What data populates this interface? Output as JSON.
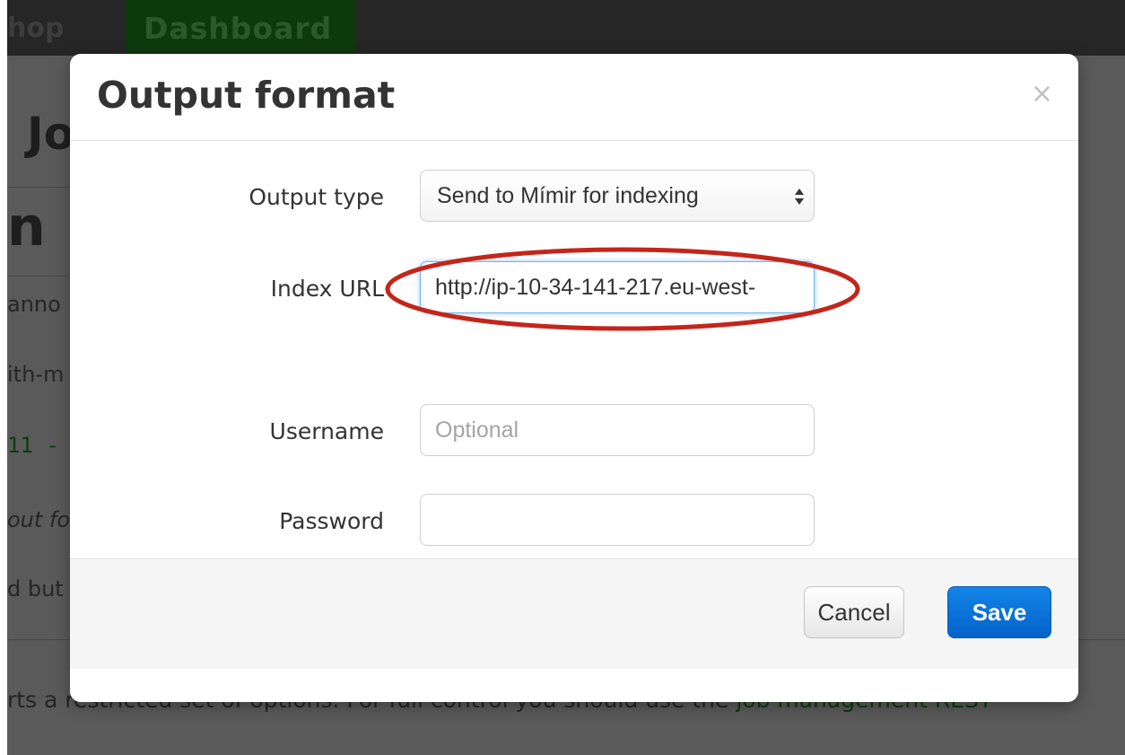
{
  "background": {
    "brand_partial": "hop",
    "nav_active": "Dashboard",
    "heading_partial": "Jo",
    "heading2_partial": "n !",
    "text_lines": [
      "anno",
      "ith-m",
      "11 - ",
      "out fo",
      "d but"
    ],
    "bottom_text": "rts a restricted set of options. For full control you should use the ",
    "bottom_link": "job management REST"
  },
  "modal": {
    "title": "Output format",
    "close_label": "×",
    "fields": {
      "output_type": {
        "label": "Output type",
        "value": "Send to Mímir for indexing"
      },
      "index_url": {
        "label": "Index URL",
        "value": "http://ip-10-34-141-217.eu-west-"
      },
      "username": {
        "label": "Username",
        "placeholder": "Optional",
        "value": ""
      },
      "password": {
        "label": "Password",
        "value": ""
      }
    },
    "buttons": {
      "cancel": "Cancel",
      "save": "Save"
    }
  },
  "colors": {
    "primary": "#0a6fd6",
    "annotation": "#c4251a",
    "nav_active": "#0d3a0d"
  }
}
